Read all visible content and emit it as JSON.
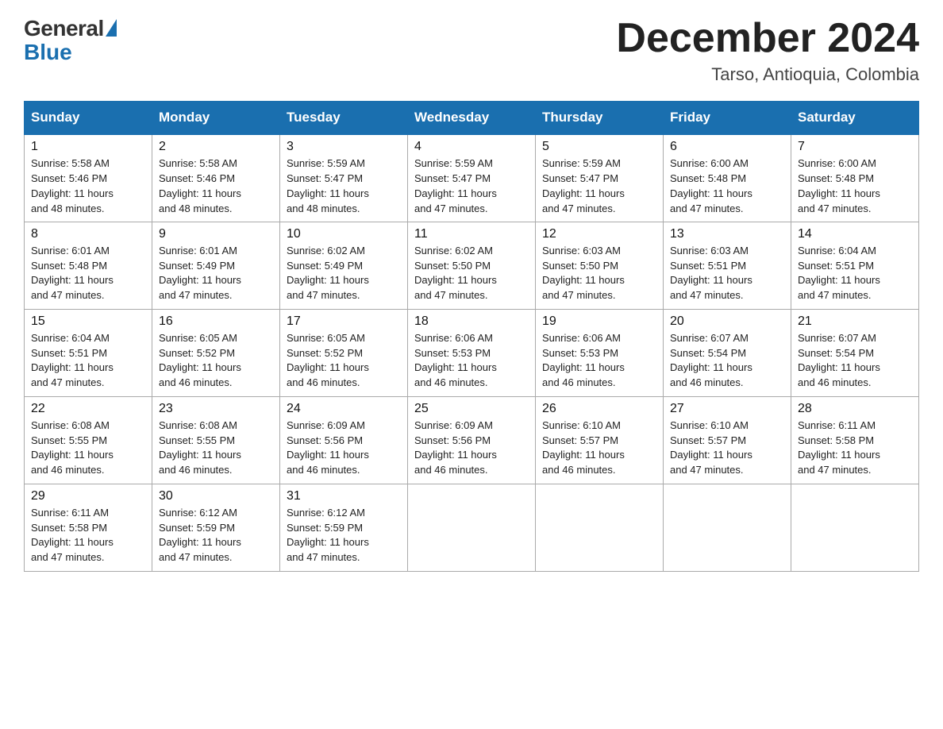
{
  "header": {
    "logo_general": "General",
    "logo_blue": "Blue",
    "month_title": "December 2024",
    "location": "Tarso, Antioquia, Colombia"
  },
  "days_of_week": [
    "Sunday",
    "Monday",
    "Tuesday",
    "Wednesday",
    "Thursday",
    "Friday",
    "Saturday"
  ],
  "weeks": [
    [
      {
        "day": "1",
        "sunrise": "5:58 AM",
        "sunset": "5:46 PM",
        "daylight": "11 hours and 48 minutes."
      },
      {
        "day": "2",
        "sunrise": "5:58 AM",
        "sunset": "5:46 PM",
        "daylight": "11 hours and 48 minutes."
      },
      {
        "day": "3",
        "sunrise": "5:59 AM",
        "sunset": "5:47 PM",
        "daylight": "11 hours and 48 minutes."
      },
      {
        "day": "4",
        "sunrise": "5:59 AM",
        "sunset": "5:47 PM",
        "daylight": "11 hours and 47 minutes."
      },
      {
        "day": "5",
        "sunrise": "5:59 AM",
        "sunset": "5:47 PM",
        "daylight": "11 hours and 47 minutes."
      },
      {
        "day": "6",
        "sunrise": "6:00 AM",
        "sunset": "5:48 PM",
        "daylight": "11 hours and 47 minutes."
      },
      {
        "day": "7",
        "sunrise": "6:00 AM",
        "sunset": "5:48 PM",
        "daylight": "11 hours and 47 minutes."
      }
    ],
    [
      {
        "day": "8",
        "sunrise": "6:01 AM",
        "sunset": "5:48 PM",
        "daylight": "11 hours and 47 minutes."
      },
      {
        "day": "9",
        "sunrise": "6:01 AM",
        "sunset": "5:49 PM",
        "daylight": "11 hours and 47 minutes."
      },
      {
        "day": "10",
        "sunrise": "6:02 AM",
        "sunset": "5:49 PM",
        "daylight": "11 hours and 47 minutes."
      },
      {
        "day": "11",
        "sunrise": "6:02 AM",
        "sunset": "5:50 PM",
        "daylight": "11 hours and 47 minutes."
      },
      {
        "day": "12",
        "sunrise": "6:03 AM",
        "sunset": "5:50 PM",
        "daylight": "11 hours and 47 minutes."
      },
      {
        "day": "13",
        "sunrise": "6:03 AM",
        "sunset": "5:51 PM",
        "daylight": "11 hours and 47 minutes."
      },
      {
        "day": "14",
        "sunrise": "6:04 AM",
        "sunset": "5:51 PM",
        "daylight": "11 hours and 47 minutes."
      }
    ],
    [
      {
        "day": "15",
        "sunrise": "6:04 AM",
        "sunset": "5:51 PM",
        "daylight": "11 hours and 47 minutes."
      },
      {
        "day": "16",
        "sunrise": "6:05 AM",
        "sunset": "5:52 PM",
        "daylight": "11 hours and 46 minutes."
      },
      {
        "day": "17",
        "sunrise": "6:05 AM",
        "sunset": "5:52 PM",
        "daylight": "11 hours and 46 minutes."
      },
      {
        "day": "18",
        "sunrise": "6:06 AM",
        "sunset": "5:53 PM",
        "daylight": "11 hours and 46 minutes."
      },
      {
        "day": "19",
        "sunrise": "6:06 AM",
        "sunset": "5:53 PM",
        "daylight": "11 hours and 46 minutes."
      },
      {
        "day": "20",
        "sunrise": "6:07 AM",
        "sunset": "5:54 PM",
        "daylight": "11 hours and 46 minutes."
      },
      {
        "day": "21",
        "sunrise": "6:07 AM",
        "sunset": "5:54 PM",
        "daylight": "11 hours and 46 minutes."
      }
    ],
    [
      {
        "day": "22",
        "sunrise": "6:08 AM",
        "sunset": "5:55 PM",
        "daylight": "11 hours and 46 minutes."
      },
      {
        "day": "23",
        "sunrise": "6:08 AM",
        "sunset": "5:55 PM",
        "daylight": "11 hours and 46 minutes."
      },
      {
        "day": "24",
        "sunrise": "6:09 AM",
        "sunset": "5:56 PM",
        "daylight": "11 hours and 46 minutes."
      },
      {
        "day": "25",
        "sunrise": "6:09 AM",
        "sunset": "5:56 PM",
        "daylight": "11 hours and 46 minutes."
      },
      {
        "day": "26",
        "sunrise": "6:10 AM",
        "sunset": "5:57 PM",
        "daylight": "11 hours and 46 minutes."
      },
      {
        "day": "27",
        "sunrise": "6:10 AM",
        "sunset": "5:57 PM",
        "daylight": "11 hours and 47 minutes."
      },
      {
        "day": "28",
        "sunrise": "6:11 AM",
        "sunset": "5:58 PM",
        "daylight": "11 hours and 47 minutes."
      }
    ],
    [
      {
        "day": "29",
        "sunrise": "6:11 AM",
        "sunset": "5:58 PM",
        "daylight": "11 hours and 47 minutes."
      },
      {
        "day": "30",
        "sunrise": "6:12 AM",
        "sunset": "5:59 PM",
        "daylight": "11 hours and 47 minutes."
      },
      {
        "day": "31",
        "sunrise": "6:12 AM",
        "sunset": "5:59 PM",
        "daylight": "11 hours and 47 minutes."
      },
      null,
      null,
      null,
      null
    ]
  ],
  "labels": {
    "sunrise": "Sunrise:",
    "sunset": "Sunset:",
    "daylight": "Daylight:"
  }
}
